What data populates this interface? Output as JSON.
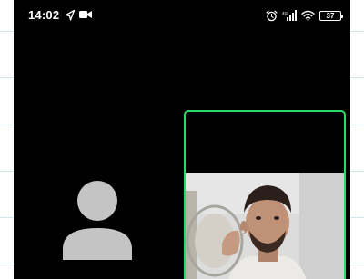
{
  "status_bar": {
    "time": "14:02",
    "battery_level": "37",
    "icons": [
      "navigation-arrow-icon",
      "video-camera-icon",
      "alarm-icon",
      "signal-icon",
      "wifi-icon",
      "battery-icon"
    ]
  },
  "call": {
    "remote_placeholder_icon": "person-avatar-icon",
    "self_view_border_color": "#2fd86b"
  }
}
